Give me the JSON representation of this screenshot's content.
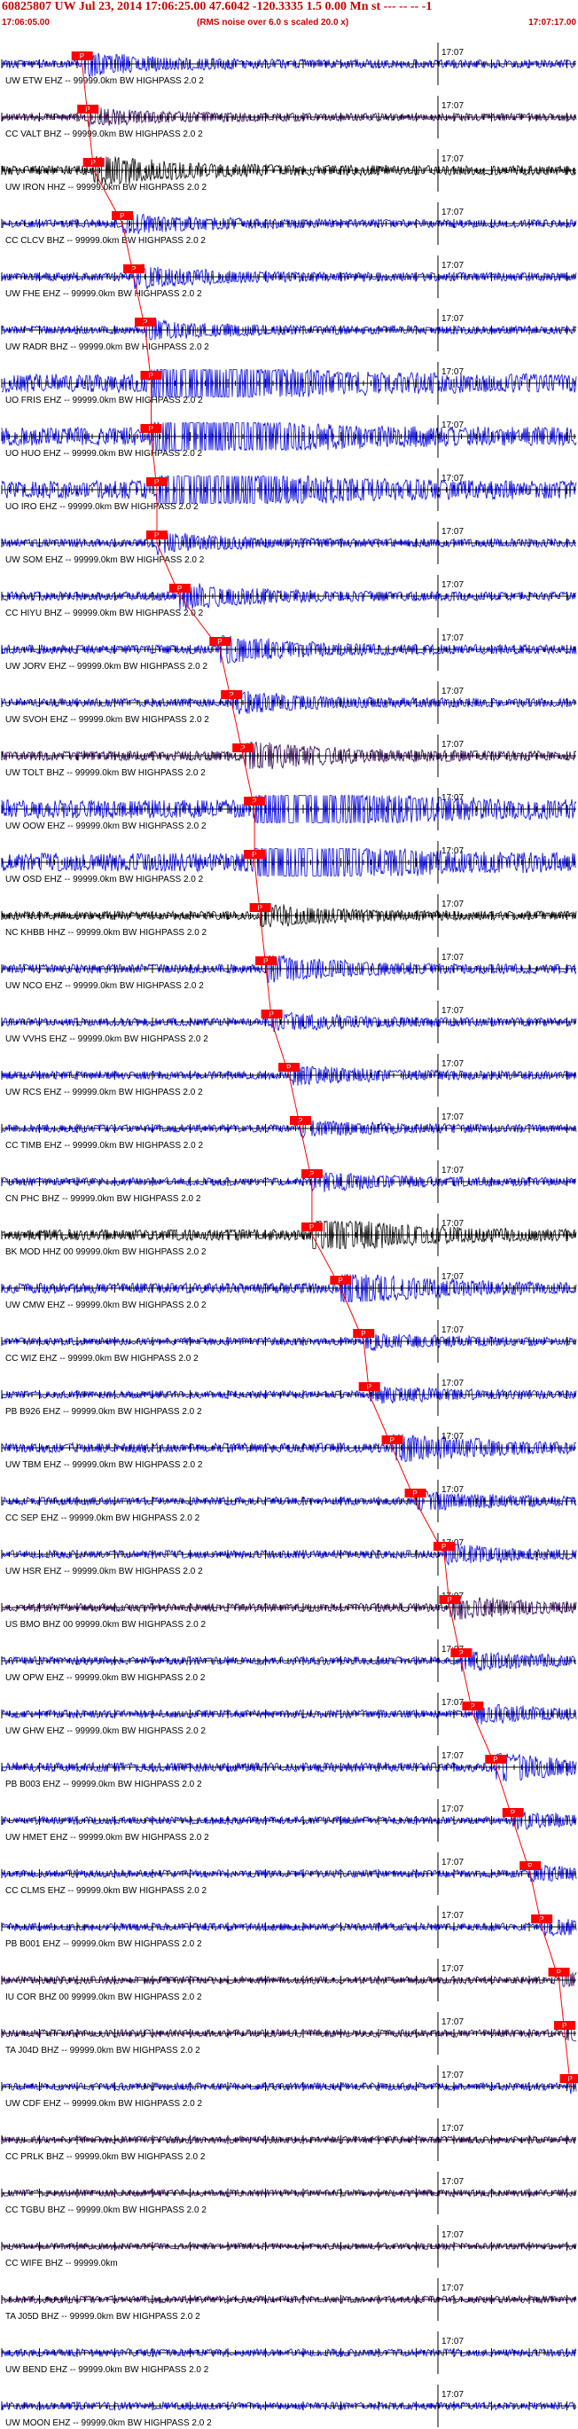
{
  "header": {
    "title": "60825807 UW Jul 23, 2014 17:06:25.00   47.6042 -120.3335  1.5 0.00 Mn st --- -- --  -1",
    "start_time": "17:06:05.00",
    "scale_note": "(RMS noise over 6.0 s scaled 20.0 x)",
    "end_time": "17:07:17.00"
  },
  "minute_label": "17:07",
  "pick_marker": "P",
  "colors": {
    "header": "#cc0000",
    "pick": "#ff0000",
    "trace_blue": "#0000dd",
    "trace_black": "#000000",
    "trace_purple": "#2a0050"
  },
  "traces": [
    {
      "label": "UW ETW EHZ -- 99999.0km BW  HIGHPASS  2.0  2",
      "color": "#0000dd",
      "amp": 0.35,
      "pick": 0.14
    },
    {
      "label": "CC VALT BHZ -- 99999.0km BW  HIGHPASS  2.0  2",
      "color": "#2a0050",
      "amp": 0.25,
      "pick": 0.15
    },
    {
      "label": "UW IRON HHZ -- 99999.0km BW  HIGHPASS  2.0  2",
      "color": "#000000",
      "amp": 0.5,
      "pick": 0.16
    },
    {
      "label": "CC CLCV BHZ -- 99999.0km BW  HIGHPASS  2.0  2",
      "color": "#0000dd",
      "amp": 0.3,
      "pick": 0.21
    },
    {
      "label": "UW FHE EHZ -- 99999.0km BW  HIGHPASS  2.0  2",
      "color": "#0000dd",
      "amp": 0.35,
      "pick": 0.23
    },
    {
      "label": "UW RADR BHZ -- 99999.0km BW  HIGHPASS  2.0  2",
      "color": "#0000dd",
      "amp": 0.3,
      "pick": 0.25
    },
    {
      "label": "UO FRIS EHZ -- 99999.0km BW  HIGHPASS  2.0  2",
      "color": "#0000dd",
      "amp": 1.6,
      "pick": 0.26
    },
    {
      "label": "UO HUO EHZ -- 99999.0km BW  HIGHPASS  2.0  2",
      "color": "#0000dd",
      "amp": 1.6,
      "pick": 0.26
    },
    {
      "label": "UO IRO EHZ -- 99999.0km BW  HIGHPASS  2.0  2",
      "color": "#0000dd",
      "amp": 1.6,
      "pick": 0.27
    },
    {
      "label": "UW SOM EHZ -- 99999.0km BW  HIGHPASS  2.0  2",
      "color": "#0000dd",
      "amp": 0.3,
      "pick": 0.27
    },
    {
      "label": "CC HIYU BHZ -- 99999.0km BW  HIGHPASS  2.0  2",
      "color": "#0000dd",
      "amp": 0.4,
      "pick": 0.31
    },
    {
      "label": "UW JORV EHZ -- 99999.0km BW  HIGHPASS  2.0  2",
      "color": "#0000dd",
      "amp": 0.45,
      "pick": 0.38
    },
    {
      "label": "UW SVOH EHZ -- 99999.0km BW  HIGHPASS  2.0  2",
      "color": "#0000dd",
      "amp": 0.35,
      "pick": 0.4
    },
    {
      "label": "UW TOLT BHZ -- 99999.0km BW  HIGHPASS  2.0  2",
      "color": "#2a0050",
      "amp": 0.5,
      "pick": 0.42
    },
    {
      "label": "UW OOW EHZ -- 99999.0km BW  HIGHPASS  2.0  2",
      "color": "#0000dd",
      "amp": 1.6,
      "pick": 0.44
    },
    {
      "label": "UW OSD EHZ -- 99999.0km BW  HIGHPASS  2.0  2",
      "color": "#0000dd",
      "amp": 1.6,
      "pick": 0.44
    },
    {
      "label": "NC KHBB HHZ -- 99999.0km BW  HIGHPASS  2.0  2",
      "color": "#000000",
      "amp": 0.35,
      "pick": 0.45
    },
    {
      "label": "UW NCO EHZ -- 99999.0km BW  HIGHPASS  2.0  2",
      "color": "#0000dd",
      "amp": 0.45,
      "pick": 0.46
    },
    {
      "label": "UW VVHS EHZ -- 99999.0km BW  HIGHPASS  2.0  2",
      "color": "#0000dd",
      "amp": 0.3,
      "pick": 0.47
    },
    {
      "label": "UW RCS EHZ -- 99999.0km BW  HIGHPASS  2.0  2",
      "color": "#0000dd",
      "amp": 0.3,
      "pick": 0.5
    },
    {
      "label": "CC TIMB EHZ -- 99999.0km BW  HIGHPASS  2.0  2",
      "color": "#0000dd",
      "amp": 0.25,
      "pick": 0.52
    },
    {
      "label": "CN PHC BHZ -- 99999.0km BW  HIGHPASS  2.0  2",
      "color": "#0000dd",
      "amp": 0.3,
      "pick": 0.54
    },
    {
      "label": "BK MOD HHZ 00 99999.0km BW  HIGHPASS  2.0  2",
      "color": "#000000",
      "amp": 0.7,
      "pick": 0.54
    },
    {
      "label": "UW CMW EHZ -- 99999.0km BW  HIGHPASS  2.0  2",
      "color": "#0000dd",
      "amp": 0.6,
      "pick": 0.59
    },
    {
      "label": "CC WIZ EHZ -- 99999.0km BW  HIGHPASS  2.0  2",
      "color": "#0000dd",
      "amp": 0.25,
      "pick": 0.63
    },
    {
      "label": "PB B926 EHZ -- 99999.0km BW  HIGHPASS  2.0  2",
      "color": "#0000dd",
      "amp": 0.25,
      "pick": 0.64
    },
    {
      "label": "UW TBM EHZ -- 99999.0km BW  HIGHPASS  2.0  2",
      "color": "#0000dd",
      "amp": 0.5,
      "pick": 0.68
    },
    {
      "label": "CC SEP EHZ -- 99999.0km BW  HIGHPASS  2.0  2",
      "color": "#0000dd",
      "amp": 0.3,
      "pick": 0.72
    },
    {
      "label": "UW HSR EHZ -- 99999.0km BW  HIGHPASS  2.0  2",
      "color": "#0000dd",
      "amp": 0.3,
      "pick": 0.77
    },
    {
      "label": "US BMO BHZ 00 99999.0km BW  HIGHPASS  2.0  2",
      "color": "#2a0050",
      "amp": 0.35,
      "pick": 0.78
    },
    {
      "label": "UW OPW EHZ -- 99999.0km BW  HIGHPASS  2.0  2",
      "color": "#0000dd",
      "amp": 0.3,
      "pick": 0.8
    },
    {
      "label": "UW GHW EHZ -- 99999.0km BW  HIGHPASS  2.0  2",
      "color": "#0000dd",
      "amp": 0.3,
      "pick": 0.82
    },
    {
      "label": "PB B003 EHZ -- 99999.0km BW  HIGHPASS  2.0  2",
      "color": "#0000dd",
      "amp": 0.45,
      "pick": 0.86
    },
    {
      "label": "UW HMET EHZ -- 99999.0km BW  HIGHPASS  2.0  2",
      "color": "#0000dd",
      "amp": 0.25,
      "pick": 0.89
    },
    {
      "label": "CC CLMS EHZ -- 99999.0km BW  HIGHPASS  2.0  2",
      "color": "#0000dd",
      "amp": 0.25,
      "pick": 0.92
    },
    {
      "label": "PB B001 EHZ -- 99999.0km BW  HIGHPASS  2.0  2",
      "color": "#0000dd",
      "amp": 0.25,
      "pick": 0.94
    },
    {
      "label": "IU COR BHZ 00 99999.0km BW  HIGHPASS  2.0  2",
      "color": "#2a0050",
      "amp": 0.25,
      "pick": 0.97
    },
    {
      "label": "TA J04D BHZ -- 99999.0km BW  HIGHPASS  2.0  2",
      "color": "#2a0050",
      "amp": 0.25,
      "pick": 0.98
    },
    {
      "label": "UW CDF EHZ -- 99999.0km BW  HIGHPASS  2.0  2",
      "color": "#0000dd",
      "amp": 0.25,
      "pick": 0.99
    },
    {
      "label": "CC PRLK BHZ -- 99999.0km BW  HIGHPASS  2.0  2",
      "color": "#2a0050",
      "amp": 0.2,
      "pick": null
    },
    {
      "label": "CC TGBU BHZ -- 99999.0km BW  HIGHPASS  2.0  2",
      "color": "#2a0050",
      "amp": 0.15,
      "pick": null
    },
    {
      "label": "CC WIFE BHZ -- 99999.0km",
      "color": "#2a0050",
      "amp": 0.1,
      "pick": null
    },
    {
      "label": "TA J05D BHZ -- 99999.0km BW  HIGHPASS  2.0  2",
      "color": "#2a0050",
      "amp": 0.2,
      "pick": null
    },
    {
      "label": "UW BEND EHZ -- 99999.0km BW  HIGHPASS  2.0  2",
      "color": "#0000dd",
      "amp": 0.25,
      "pick": null
    },
    {
      "label": "UW MOON EHZ -- 99999.0km BW  HIGHPASS  2.0  2",
      "color": "#0000dd",
      "amp": 0.25,
      "pick": null
    }
  ]
}
